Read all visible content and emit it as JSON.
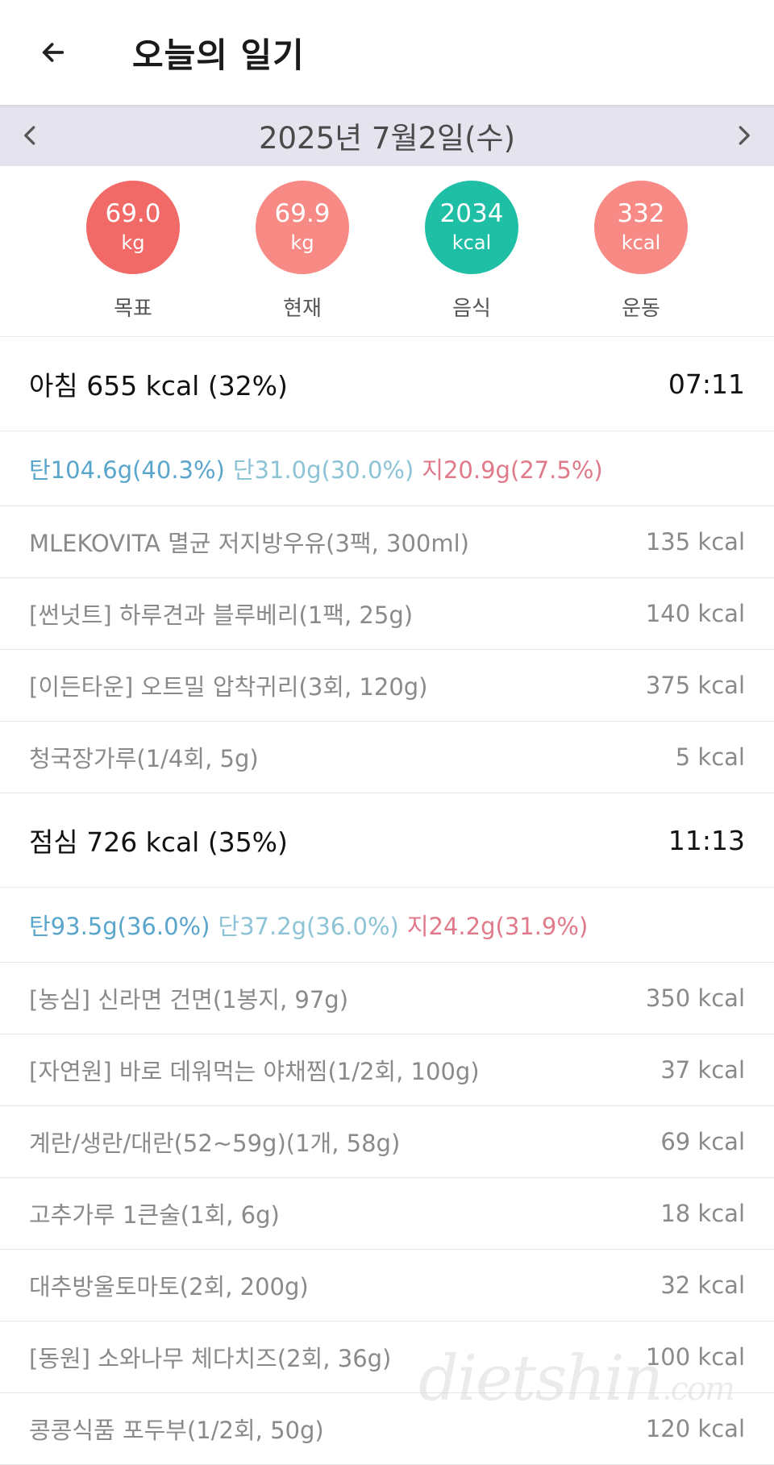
{
  "header": {
    "title": "오늘의 일기",
    "back_icon": "arrow-left-icon"
  },
  "date_nav": {
    "date": "2025년 7월2일(수)",
    "prev_icon": "chevron-left-icon",
    "next_icon": "chevron-right-icon"
  },
  "stats": [
    {
      "value": "69.0",
      "unit": "kg",
      "label": "목표",
      "color": "#f26a67"
    },
    {
      "value": "69.9",
      "unit": "kg",
      "label": "현재",
      "color": "#f78a85"
    },
    {
      "value": "2034",
      "unit": "kcal",
      "label": "음식",
      "color": "#1fbfa6"
    },
    {
      "value": "332",
      "unit": "kcal",
      "label": "운동",
      "color": "#f78a85"
    }
  ],
  "meals": [
    {
      "title": "아침 655 kcal (32%)",
      "time": "07:11",
      "carb": "탄104.6g(40.3%)",
      "protein": "단31.0g(30.0%)",
      "fat": "지20.9g(27.5%)",
      "foods": [
        {
          "name": "MLEKOVITA 멸균 저지방우유(3팩, 300ml)",
          "kcal": "135 kcal"
        },
        {
          "name": "[썬넛트] 하루견과 블루베리(1팩, 25g)",
          "kcal": "140 kcal"
        },
        {
          "name": "[이든타운] 오트밀 압착귀리(3회, 120g)",
          "kcal": "375 kcal"
        },
        {
          "name": "청국장가루(1/4회, 5g)",
          "kcal": "5 kcal"
        }
      ]
    },
    {
      "title": "점심 726 kcal (35%)",
      "time": "11:13",
      "carb": "탄93.5g(36.0%)",
      "protein": "단37.2g(36.0%)",
      "fat": "지24.2g(31.9%)",
      "foods": [
        {
          "name": "[농심] 신라면 건면(1봉지, 97g)",
          "kcal": "350 kcal"
        },
        {
          "name": "[자연원] 바로 데워먹는 야채찜(1/2회, 100g)",
          "kcal": "37 kcal"
        },
        {
          "name": "계란/생란/대란(52~59g)(1개, 58g)",
          "kcal": "69 kcal"
        },
        {
          "name": "고추가루 1큰술(1회, 6g)",
          "kcal": "18 kcal"
        },
        {
          "name": "대추방울토마토(2회, 200g)",
          "kcal": "32 kcal"
        },
        {
          "name": "[동원] 소와나무 체다치즈(2회, 36g)",
          "kcal": "100 kcal"
        },
        {
          "name": "콩콩식품 포두부(1/2회, 50g)",
          "kcal": "120 kcal"
        }
      ]
    }
  ],
  "watermark": {
    "main": "dietshin",
    "suffix": ".com"
  }
}
